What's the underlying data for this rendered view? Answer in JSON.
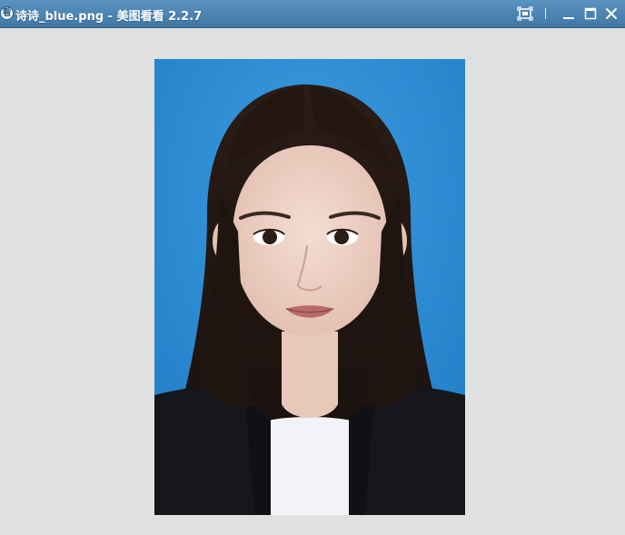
{
  "window": {
    "title": "诗诗_blue.png - 美图看看 2.2.7",
    "app_icon_glyph": "看"
  },
  "toolbar": {
    "fit_icon": "fit-to-window-icon",
    "minimize_icon": "minimize-icon",
    "maximize_icon": "maximize-icon",
    "close_icon": "close-icon"
  },
  "image": {
    "background_color": "#2e8bd3"
  }
}
